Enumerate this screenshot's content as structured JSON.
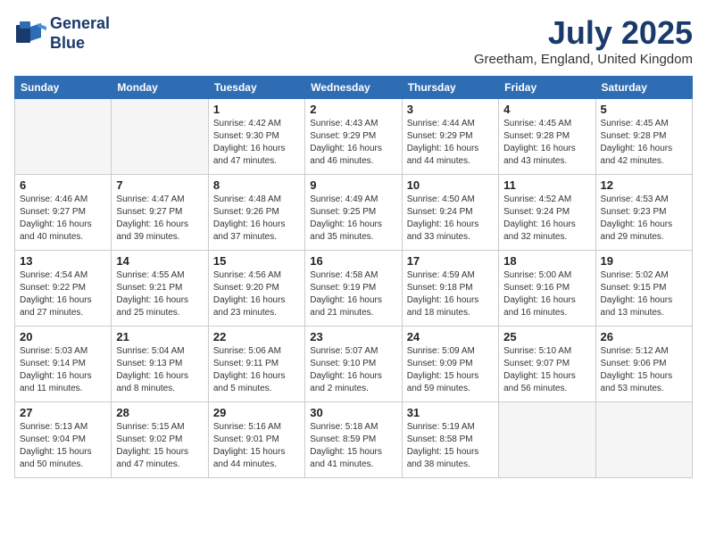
{
  "logo": {
    "line1": "General",
    "line2": "Blue"
  },
  "title": "July 2025",
  "location": "Greetham, England, United Kingdom",
  "days_of_week": [
    "Sunday",
    "Monday",
    "Tuesday",
    "Wednesday",
    "Thursday",
    "Friday",
    "Saturday"
  ],
  "weeks": [
    [
      {
        "day": "",
        "info": ""
      },
      {
        "day": "",
        "info": ""
      },
      {
        "day": "1",
        "info": "Sunrise: 4:42 AM\nSunset: 9:30 PM\nDaylight: 16 hours\nand 47 minutes."
      },
      {
        "day": "2",
        "info": "Sunrise: 4:43 AM\nSunset: 9:29 PM\nDaylight: 16 hours\nand 46 minutes."
      },
      {
        "day": "3",
        "info": "Sunrise: 4:44 AM\nSunset: 9:29 PM\nDaylight: 16 hours\nand 44 minutes."
      },
      {
        "day": "4",
        "info": "Sunrise: 4:45 AM\nSunset: 9:28 PM\nDaylight: 16 hours\nand 43 minutes."
      },
      {
        "day": "5",
        "info": "Sunrise: 4:45 AM\nSunset: 9:28 PM\nDaylight: 16 hours\nand 42 minutes."
      }
    ],
    [
      {
        "day": "6",
        "info": "Sunrise: 4:46 AM\nSunset: 9:27 PM\nDaylight: 16 hours\nand 40 minutes."
      },
      {
        "day": "7",
        "info": "Sunrise: 4:47 AM\nSunset: 9:27 PM\nDaylight: 16 hours\nand 39 minutes."
      },
      {
        "day": "8",
        "info": "Sunrise: 4:48 AM\nSunset: 9:26 PM\nDaylight: 16 hours\nand 37 minutes."
      },
      {
        "day": "9",
        "info": "Sunrise: 4:49 AM\nSunset: 9:25 PM\nDaylight: 16 hours\nand 35 minutes."
      },
      {
        "day": "10",
        "info": "Sunrise: 4:50 AM\nSunset: 9:24 PM\nDaylight: 16 hours\nand 33 minutes."
      },
      {
        "day": "11",
        "info": "Sunrise: 4:52 AM\nSunset: 9:24 PM\nDaylight: 16 hours\nand 32 minutes."
      },
      {
        "day": "12",
        "info": "Sunrise: 4:53 AM\nSunset: 9:23 PM\nDaylight: 16 hours\nand 29 minutes."
      }
    ],
    [
      {
        "day": "13",
        "info": "Sunrise: 4:54 AM\nSunset: 9:22 PM\nDaylight: 16 hours\nand 27 minutes."
      },
      {
        "day": "14",
        "info": "Sunrise: 4:55 AM\nSunset: 9:21 PM\nDaylight: 16 hours\nand 25 minutes."
      },
      {
        "day": "15",
        "info": "Sunrise: 4:56 AM\nSunset: 9:20 PM\nDaylight: 16 hours\nand 23 minutes."
      },
      {
        "day": "16",
        "info": "Sunrise: 4:58 AM\nSunset: 9:19 PM\nDaylight: 16 hours\nand 21 minutes."
      },
      {
        "day": "17",
        "info": "Sunrise: 4:59 AM\nSunset: 9:18 PM\nDaylight: 16 hours\nand 18 minutes."
      },
      {
        "day": "18",
        "info": "Sunrise: 5:00 AM\nSunset: 9:16 PM\nDaylight: 16 hours\nand 16 minutes."
      },
      {
        "day": "19",
        "info": "Sunrise: 5:02 AM\nSunset: 9:15 PM\nDaylight: 16 hours\nand 13 minutes."
      }
    ],
    [
      {
        "day": "20",
        "info": "Sunrise: 5:03 AM\nSunset: 9:14 PM\nDaylight: 16 hours\nand 11 minutes."
      },
      {
        "day": "21",
        "info": "Sunrise: 5:04 AM\nSunset: 9:13 PM\nDaylight: 16 hours\nand 8 minutes."
      },
      {
        "day": "22",
        "info": "Sunrise: 5:06 AM\nSunset: 9:11 PM\nDaylight: 16 hours\nand 5 minutes."
      },
      {
        "day": "23",
        "info": "Sunrise: 5:07 AM\nSunset: 9:10 PM\nDaylight: 16 hours\nand 2 minutes."
      },
      {
        "day": "24",
        "info": "Sunrise: 5:09 AM\nSunset: 9:09 PM\nDaylight: 15 hours\nand 59 minutes."
      },
      {
        "day": "25",
        "info": "Sunrise: 5:10 AM\nSunset: 9:07 PM\nDaylight: 15 hours\nand 56 minutes."
      },
      {
        "day": "26",
        "info": "Sunrise: 5:12 AM\nSunset: 9:06 PM\nDaylight: 15 hours\nand 53 minutes."
      }
    ],
    [
      {
        "day": "27",
        "info": "Sunrise: 5:13 AM\nSunset: 9:04 PM\nDaylight: 15 hours\nand 50 minutes."
      },
      {
        "day": "28",
        "info": "Sunrise: 5:15 AM\nSunset: 9:02 PM\nDaylight: 15 hours\nand 47 minutes."
      },
      {
        "day": "29",
        "info": "Sunrise: 5:16 AM\nSunset: 9:01 PM\nDaylight: 15 hours\nand 44 minutes."
      },
      {
        "day": "30",
        "info": "Sunrise: 5:18 AM\nSunset: 8:59 PM\nDaylight: 15 hours\nand 41 minutes."
      },
      {
        "day": "31",
        "info": "Sunrise: 5:19 AM\nSunset: 8:58 PM\nDaylight: 15 hours\nand 38 minutes."
      },
      {
        "day": "",
        "info": ""
      },
      {
        "day": "",
        "info": ""
      }
    ]
  ]
}
